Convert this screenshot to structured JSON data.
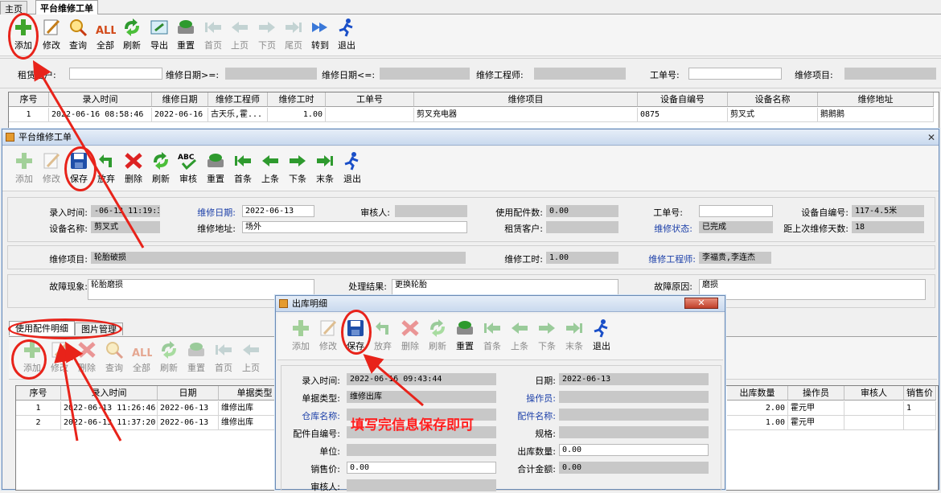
{
  "tabs": [
    "主页",
    "平台维修工单"
  ],
  "main": {
    "toolbar": [
      "添加",
      "修改",
      "查询",
      "全部",
      "刷新",
      "导出",
      "重置",
      "首页",
      "上页",
      "下页",
      "尾页",
      "转到",
      "退出"
    ],
    "filters": {
      "customer": "租赁客户:",
      "date_from": "维修日期>=:",
      "date_to": "维修日期<=:",
      "engineer": "维修工程师:",
      "order_no": "工单号:",
      "item": "维修项目:"
    },
    "columns": [
      "序号",
      "录入时间",
      "维修日期",
      "维修工程师",
      "维修工时",
      "工单号",
      "维修项目",
      "设备自编号",
      "设备名称",
      "维修地址"
    ],
    "rows": [
      [
        "1",
        "2022-06-16 08:58:46",
        "2022-06-16",
        "古天乐,霍...",
        "1.00",
        "",
        "剪叉充电器",
        "0875",
        "剪叉式",
        "鹅鹅鹅"
      ]
    ]
  },
  "order_window": {
    "title": "平台维修工单",
    "close": "✕",
    "toolbar": [
      "添加",
      "修改",
      "保存",
      "放弃",
      "删除",
      "刷新",
      "审核",
      "重置",
      "首条",
      "上条",
      "下条",
      "末条",
      "退出"
    ],
    "labels": {
      "entry_time": "录入时间:",
      "repair_date": "维修日期:",
      "auditor": "审核人:",
      "parts_count": "使用配件数:",
      "order_no": "工单号:",
      "device_code": "设备自编号:",
      "device_name": "设备名称:",
      "address": "维修地址:",
      "customer": "租赁客户:",
      "status": "维修状态:",
      "days_since": "距上次维修天数:",
      "item": "维修项目:",
      "hours": "维修工时:",
      "engineer": "维修工程师:",
      "fault": "故障现象:",
      "result": "处理结果:",
      "cause": "故障原因:"
    },
    "values": {
      "entry_time": "-06-13 11:19:31",
      "repair_date": "2022-06-13",
      "auditor": "",
      "parts_count": "0.00",
      "order_no": "",
      "device_code": "117-4.5米",
      "device_name": "剪叉式",
      "address": "场外",
      "customer": "",
      "status": "已完成",
      "days_since": "18",
      "item": "轮胎破损",
      "hours": "1.00",
      "engineer": "李福贵,李连杰",
      "fault": "轮胎磨损",
      "result": "更换轮胎",
      "cause": "磨损"
    },
    "subtabs": [
      "使用配件明细",
      "图片管理"
    ],
    "sub_toolbar": [
      "添加",
      "修改",
      "删除",
      "查询",
      "全部",
      "刷新",
      "重置",
      "首页",
      "上页"
    ],
    "sub_columns": [
      "序号",
      "录入时间",
      "日期",
      "单据类型"
    ],
    "sub_rows": [
      [
        "1",
        "2022-06-13 11:26:46",
        "2022-06-13",
        "维修出库"
      ],
      [
        "2",
        "2022-06-13 11:37:20",
        "2022-06-13",
        "维修出库"
      ]
    ],
    "right_columns": [
      "出库数量",
      "操作员",
      "审核人",
      "销售价"
    ],
    "right_rows": [
      [
        "2.00",
        "霍元甲",
        "",
        "1"
      ],
      [
        "1.00",
        "霍元甲",
        "",
        ""
      ]
    ]
  },
  "out_window": {
    "title": "出库明细",
    "close": "✕",
    "toolbar": [
      "添加",
      "修改",
      "保存",
      "放弃",
      "删除",
      "刷新",
      "重置",
      "首条",
      "上条",
      "下条",
      "末条",
      "退出"
    ],
    "labels": {
      "entry_time": "录入时间:",
      "date": "日期:",
      "doc_type": "单据类型:",
      "operator": "操作员:",
      "warehouse": "仓库名称:",
      "part_name": "配件名称:",
      "part_code": "配件自编号:",
      "spec": "规格:",
      "unit": "单位:",
      "qty": "出库数量:",
      "price": "销售价:",
      "total": "合计金额:",
      "auditor": "审核人:"
    },
    "values": {
      "entry_time": "2022-06-16 09:43:44",
      "date": "2022-06-13",
      "doc_type": "维修出库",
      "operator": "",
      "warehouse": "",
      "part_name": "",
      "part_code": "",
      "spec": "",
      "unit": "",
      "qty": "0.00",
      "price": "0.00",
      "total": "0.00",
      "auditor": ""
    }
  },
  "annotation": "填写完信息保存即可",
  "colors": {
    "annotation": "#e8231a",
    "label_blue": "#1a3ea8",
    "readonly": "#c8c8c8"
  }
}
